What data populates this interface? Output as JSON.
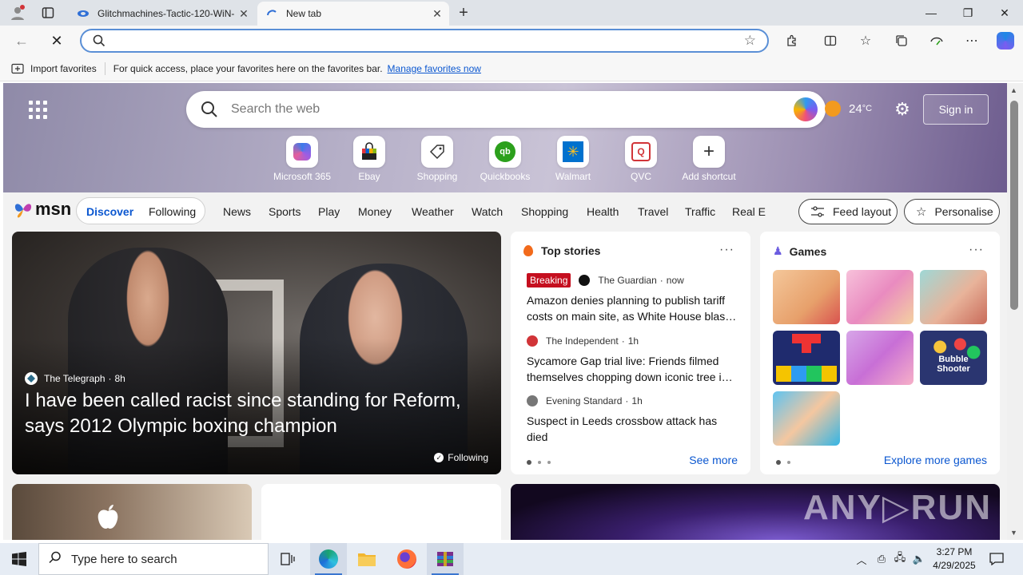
{
  "browser": {
    "tabs": [
      {
        "title": "Glitchmachines-Tactic-120-WiN-",
        "close": "✕"
      },
      {
        "title": "New tab",
        "close": "✕"
      }
    ],
    "new_tab_symbol": "+",
    "window_controls": {
      "minimize": "—",
      "restore": "❐",
      "close": "✕"
    },
    "address_value": "",
    "icons": [
      "profile-icon",
      "tab-actions-icon",
      "back-icon",
      "stop-icon",
      "search-icon",
      "favorite-star-icon",
      "extensions-icon",
      "split-screen-icon",
      "favorites-icon",
      "collections-icon",
      "performance-icon",
      "more-icon",
      "copilot-icon"
    ]
  },
  "favorites_bar": {
    "import_label": "Import favorites",
    "hint": "For quick access, place your favorites here on the favorites bar.",
    "manage_link": "Manage favorites now"
  },
  "msn": {
    "search_placeholder": "Search the web",
    "temperature": "24",
    "temp_unit": "°C",
    "sign_in": "Sign in",
    "shortcuts": [
      {
        "label": "Microsoft 365",
        "icon": "microsoft365-icon"
      },
      {
        "label": "Ebay",
        "icon": "ebay-icon"
      },
      {
        "label": "Shopping",
        "icon": "shopping-tag-icon"
      },
      {
        "label": "Quickbooks",
        "icon": "quickbooks-icon"
      },
      {
        "label": "Walmart",
        "icon": "walmart-icon"
      },
      {
        "label": "QVC",
        "icon": "qvc-icon"
      },
      {
        "label": "Add shortcut",
        "icon": "plus-icon"
      }
    ],
    "logo_text": "msn",
    "feed_tabs": {
      "discover": "Discover",
      "following": "Following"
    },
    "nav_links": [
      "News",
      "Sports",
      "Play",
      "Money",
      "Weather",
      "Watch",
      "Shopping",
      "Health",
      "Travel",
      "Traffic",
      "Real E"
    ],
    "feed_layout": "Feed layout",
    "personalise": "Personalise"
  },
  "lead_story": {
    "source": "The Telegraph",
    "age": "8h",
    "headline": "I have been called racist since standing for Reform, says 2012 Olympic boxing champion",
    "follow_state": "Following"
  },
  "top_stories": {
    "heading": "Top stories",
    "more": "···",
    "items": [
      {
        "badge": "Breaking",
        "source": "The Guardian",
        "age": "now",
        "title": "Amazon denies planning to publish tariff costs on main site, as White House blas…"
      },
      {
        "badge": "",
        "source": "The Independent",
        "age": "1h",
        "title": "Sycamore Gap trial live: Friends filmed themselves chopping down iconic tree i…"
      },
      {
        "badge": "",
        "source": "Evening Standard",
        "age": "1h",
        "title": "Suspect in Leeds crossbow attack has died"
      }
    ],
    "see_more": "See more"
  },
  "games": {
    "heading": "Games",
    "more": "···",
    "tiles": [
      "Bubble Shooter"
    ],
    "explore": "Explore more games"
  },
  "watermark": "ANY▷RUN",
  "taskbar": {
    "search_placeholder": "Type here to search",
    "time": "3:27 PM",
    "date": "4/29/2025"
  },
  "colors": {
    "accent": "#0b57d0",
    "breaking": "#c50f1f",
    "quickbooks": "#2ca01c",
    "walmart": "#0071ce"
  }
}
